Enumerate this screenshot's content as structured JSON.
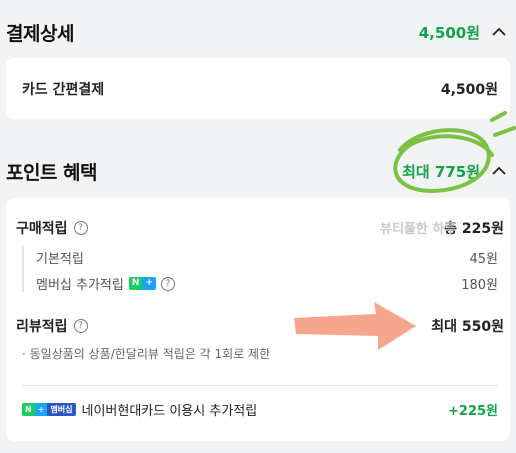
{
  "payment": {
    "title": "결제상세",
    "total": "4,500원",
    "method_label": "카드 간편결제",
    "method_amount": "4,500원"
  },
  "points": {
    "title": "포인트 혜택",
    "max_total": "최대 775원",
    "purchase": {
      "label": "구매적립",
      "total": "총 225원",
      "items": [
        {
          "label": "기본적립",
          "value": "45원"
        },
        {
          "label": "멤버십 추가적립",
          "value": "180원"
        }
      ]
    },
    "review": {
      "label": "리뷰적립",
      "total": "최대 550원",
      "note": "· 동일상품의 상품/한달리뷰 적립은 각 1회로 제한"
    },
    "card_bonus": {
      "label": "네이버현대카드 이용시 추가적립",
      "value": "+225원"
    }
  },
  "badges": {
    "nplus_n": "N",
    "nplus_plus": "+",
    "membership": "멤버십"
  },
  "watermark": "뷰티풀한 하루",
  "colors": {
    "accent_green": "#12a34a",
    "annotation_green": "#7cc242",
    "arrow": "#f4967a"
  }
}
